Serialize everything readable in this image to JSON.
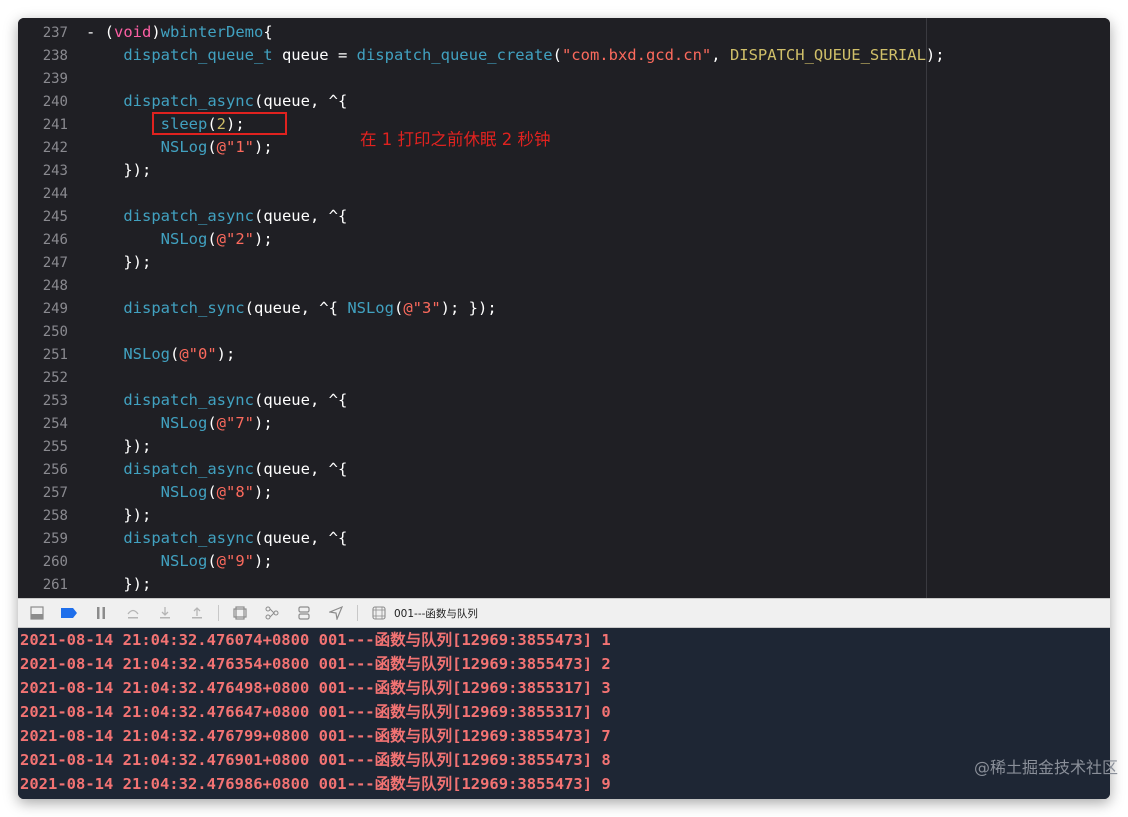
{
  "editor": {
    "lines": [
      {
        "num": "237",
        "tokens": [
          {
            "t": "- (",
            "c": ""
          },
          {
            "t": "void",
            "c": "k"
          },
          {
            "t": ")",
            "c": ""
          },
          {
            "t": "wbinterDemo",
            "c": "f"
          },
          {
            "t": "{",
            "c": ""
          }
        ]
      },
      {
        "num": "238",
        "tokens": [
          {
            "t": "    ",
            "c": ""
          },
          {
            "t": "dispatch_queue_t",
            "c": "f"
          },
          {
            "t": " queue = ",
            "c": ""
          },
          {
            "t": "dispatch_queue_create",
            "c": "f"
          },
          {
            "t": "(",
            "c": ""
          },
          {
            "t": "\"com.bxd.gcd.cn\"",
            "c": "s"
          },
          {
            "t": ", ",
            "c": ""
          },
          {
            "t": "DISPATCH_QUEUE_SERIAL",
            "c": "m"
          },
          {
            "t": ");",
            "c": ""
          }
        ]
      },
      {
        "num": "239",
        "tokens": []
      },
      {
        "num": "240",
        "tokens": [
          {
            "t": "    ",
            "c": ""
          },
          {
            "t": "dispatch_async",
            "c": "f"
          },
          {
            "t": "(queue, ^{",
            "c": ""
          }
        ]
      },
      {
        "num": "241",
        "tokens": [
          {
            "t": "        ",
            "c": ""
          },
          {
            "t": "sleep",
            "c": "f"
          },
          {
            "t": "(",
            "c": ""
          },
          {
            "t": "2",
            "c": "n"
          },
          {
            "t": ");",
            "c": ""
          }
        ]
      },
      {
        "num": "242",
        "tokens": [
          {
            "t": "        ",
            "c": ""
          },
          {
            "t": "NSLog",
            "c": "f"
          },
          {
            "t": "(",
            "c": ""
          },
          {
            "t": "@\"1\"",
            "c": "s"
          },
          {
            "t": ");",
            "c": ""
          }
        ]
      },
      {
        "num": "243",
        "tokens": [
          {
            "t": "    });",
            "c": ""
          }
        ]
      },
      {
        "num": "244",
        "tokens": []
      },
      {
        "num": "245",
        "tokens": [
          {
            "t": "    ",
            "c": ""
          },
          {
            "t": "dispatch_async",
            "c": "f"
          },
          {
            "t": "(queue, ^{",
            "c": ""
          }
        ]
      },
      {
        "num": "246",
        "tokens": [
          {
            "t": "        ",
            "c": ""
          },
          {
            "t": "NSLog",
            "c": "f"
          },
          {
            "t": "(",
            "c": ""
          },
          {
            "t": "@\"2\"",
            "c": "s"
          },
          {
            "t": ");",
            "c": ""
          }
        ]
      },
      {
        "num": "247",
        "tokens": [
          {
            "t": "    });",
            "c": ""
          }
        ]
      },
      {
        "num": "248",
        "tokens": []
      },
      {
        "num": "249",
        "tokens": [
          {
            "t": "    ",
            "c": ""
          },
          {
            "t": "dispatch_sync",
            "c": "f"
          },
          {
            "t": "(queue, ^{ ",
            "c": ""
          },
          {
            "t": "NSLog",
            "c": "f"
          },
          {
            "t": "(",
            "c": ""
          },
          {
            "t": "@\"3\"",
            "c": "s"
          },
          {
            "t": "); });",
            "c": ""
          }
        ]
      },
      {
        "num": "250",
        "tokens": []
      },
      {
        "num": "251",
        "tokens": [
          {
            "t": "    ",
            "c": ""
          },
          {
            "t": "NSLog",
            "c": "f"
          },
          {
            "t": "(",
            "c": ""
          },
          {
            "t": "@\"0\"",
            "c": "s"
          },
          {
            "t": ");",
            "c": ""
          }
        ]
      },
      {
        "num": "252",
        "tokens": []
      },
      {
        "num": "253",
        "tokens": [
          {
            "t": "    ",
            "c": ""
          },
          {
            "t": "dispatch_async",
            "c": "f"
          },
          {
            "t": "(queue, ^{",
            "c": ""
          }
        ]
      },
      {
        "num": "254",
        "tokens": [
          {
            "t": "        ",
            "c": ""
          },
          {
            "t": "NSLog",
            "c": "f"
          },
          {
            "t": "(",
            "c": ""
          },
          {
            "t": "@\"7\"",
            "c": "s"
          },
          {
            "t": ");",
            "c": ""
          }
        ]
      },
      {
        "num": "255",
        "tokens": [
          {
            "t": "    });",
            "c": ""
          }
        ]
      },
      {
        "num": "256",
        "tokens": [
          {
            "t": "    ",
            "c": ""
          },
          {
            "t": "dispatch_async",
            "c": "f"
          },
          {
            "t": "(queue, ^{",
            "c": ""
          }
        ]
      },
      {
        "num": "257",
        "tokens": [
          {
            "t": "        ",
            "c": ""
          },
          {
            "t": "NSLog",
            "c": "f"
          },
          {
            "t": "(",
            "c": ""
          },
          {
            "t": "@\"8\"",
            "c": "s"
          },
          {
            "t": ");",
            "c": ""
          }
        ]
      },
      {
        "num": "258",
        "tokens": [
          {
            "t": "    });",
            "c": ""
          }
        ]
      },
      {
        "num": "259",
        "tokens": [
          {
            "t": "    ",
            "c": ""
          },
          {
            "t": "dispatch_async",
            "c": "f"
          },
          {
            "t": "(queue, ^{",
            "c": ""
          }
        ]
      },
      {
        "num": "260",
        "tokens": [
          {
            "t": "        ",
            "c": ""
          },
          {
            "t": "NSLog",
            "c": "f"
          },
          {
            "t": "(",
            "c": ""
          },
          {
            "t": "@\"9\"",
            "c": "s"
          },
          {
            "t": ");",
            "c": ""
          }
        ]
      },
      {
        "num": "261",
        "tokens": [
          {
            "t": "    });",
            "c": ""
          }
        ]
      }
    ],
    "annotation": "在 1 打印之前休眠 2 秒钟"
  },
  "debugbar": {
    "buttons": [
      "hide-console-icon",
      "breakpoints-icon",
      "pause-icon",
      "step-over-icon",
      "step-into-icon",
      "step-out-icon",
      "view-hierarchy-icon",
      "memory-graph-icon",
      "environment-icon",
      "location-icon"
    ],
    "target_label": "001---函数与队列"
  },
  "console": {
    "lines": [
      "2021-08-14 21:04:32.476074+0800 001---函数与队列[12969:3855473] 1",
      "2021-08-14 21:04:32.476354+0800 001---函数与队列[12969:3855473] 2",
      "2021-08-14 21:04:32.476498+0800 001---函数与队列[12969:3855317] 3",
      "2021-08-14 21:04:32.476647+0800 001---函数与队列[12969:3855317] 0",
      "2021-08-14 21:04:32.476799+0800 001---函数与队列[12969:3855473] 7",
      "2021-08-14 21:04:32.476901+0800 001---函数与队列[12969:3855473] 8",
      "2021-08-14 21:04:32.476986+0800 001---函数与队列[12969:3855473] 9"
    ]
  },
  "watermark": "@稀土掘金技术社区",
  "colors": {
    "keyword": "#fc5fa3",
    "function": "#41a1c0",
    "string": "#fc6a5d",
    "macro": "#d0bf69",
    "annotation": "#e0221f",
    "console_text": "#f37373"
  }
}
